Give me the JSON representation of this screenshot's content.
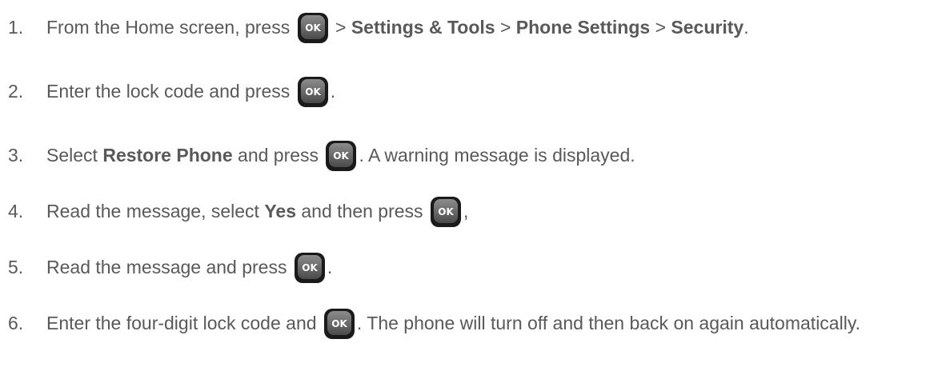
{
  "steps": [
    {
      "num": "1.",
      "parts": [
        {
          "t": "text",
          "v": "From the Home screen, press "
        },
        {
          "t": "key",
          "v": "OK"
        },
        {
          "t": "text",
          "v": " > "
        },
        {
          "t": "bold",
          "v": "Settings & Tools"
        },
        {
          "t": "text",
          "v": " > "
        },
        {
          "t": "bold",
          "v": "Phone Settings"
        },
        {
          "t": "text",
          "v": " > "
        },
        {
          "t": "bold",
          "v": "Security"
        },
        {
          "t": "text",
          "v": "."
        }
      ]
    },
    {
      "num": "2.",
      "parts": [
        {
          "t": "text",
          "v": "Enter the lock code and press "
        },
        {
          "t": "key",
          "v": "OK"
        },
        {
          "t": "text",
          "v": "."
        }
      ]
    },
    {
      "num": "3.",
      "parts": [
        {
          "t": "text",
          "v": "Select "
        },
        {
          "t": "bold",
          "v": "Restore Phone"
        },
        {
          "t": "text",
          "v": " and press "
        },
        {
          "t": "key",
          "v": "OK"
        },
        {
          "t": "text",
          "v": ". A warning message is displayed."
        }
      ]
    },
    {
      "num": "4.",
      "parts": [
        {
          "t": "text",
          "v": "Read the message, select "
        },
        {
          "t": "bold",
          "v": "Yes"
        },
        {
          "t": "text",
          "v": " and then press "
        },
        {
          "t": "key",
          "v": "OK"
        },
        {
          "t": "text",
          "v": ","
        }
      ]
    },
    {
      "num": "5.",
      "parts": [
        {
          "t": "text",
          "v": "Read the message and press "
        },
        {
          "t": "key",
          "v": "OK"
        },
        {
          "t": "text",
          "v": "."
        }
      ]
    },
    {
      "num": "6.",
      "parts": [
        {
          "t": "text",
          "v": "Enter the four-digit lock code and "
        },
        {
          "t": "key",
          "v": "OK"
        },
        {
          "t": "text",
          "v": ". The phone will turn off and then back on again automatically."
        }
      ]
    }
  ],
  "colors": {
    "text": "#595959",
    "key_face": "#6b6b6b",
    "key_border": "#1a1a1a",
    "key_label": "#ffffff"
  },
  "icons": {
    "key": "ok-key-icon"
  }
}
